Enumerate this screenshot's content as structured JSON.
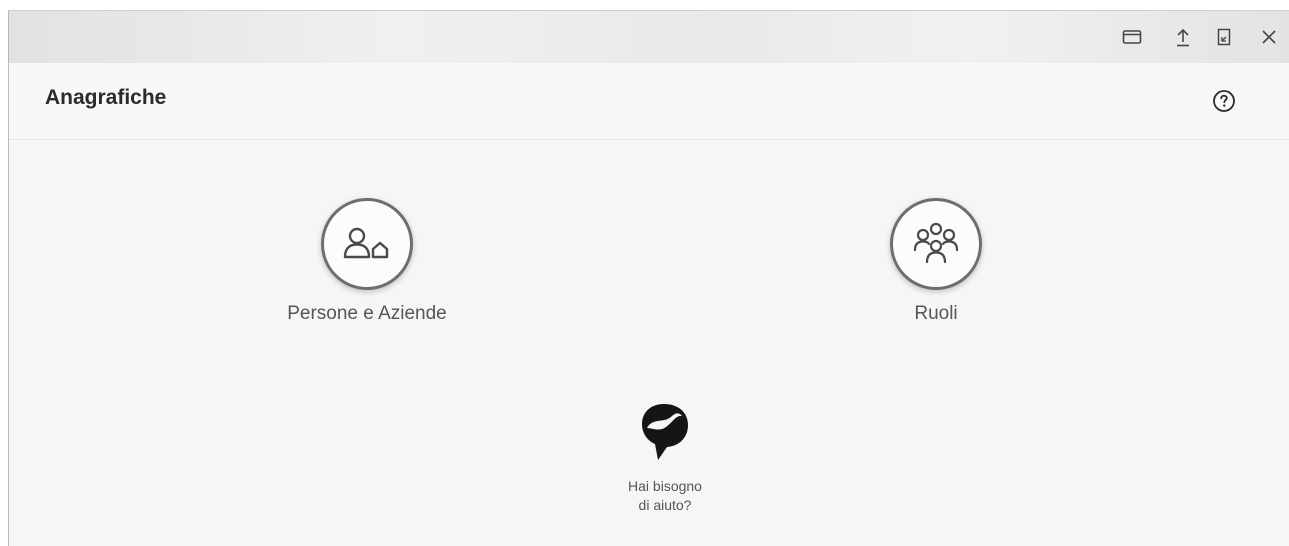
{
  "window": {
    "controls": [
      {
        "icon": "window-restore-icon"
      },
      {
        "icon": "upload-icon"
      },
      {
        "icon": "bookmark-icon"
      },
      {
        "icon": "close-icon"
      }
    ]
  },
  "header": {
    "title": "Anagrafiche",
    "help_icon": "help-circle-icon"
  },
  "tiles": [
    {
      "label": "Persone e Aziende",
      "icon": "person-company-icon"
    },
    {
      "label": "Ruoli",
      "icon": "group-roles-icon"
    }
  ],
  "help_widget": {
    "icon": "support-logo-icon",
    "line1": "Hai bisogno",
    "line2": "di aiuto?"
  },
  "colors": {
    "icon_stroke": "#4a4a4a",
    "circle_border": "#6e6e6e",
    "title_text": "#2b2b2b"
  }
}
